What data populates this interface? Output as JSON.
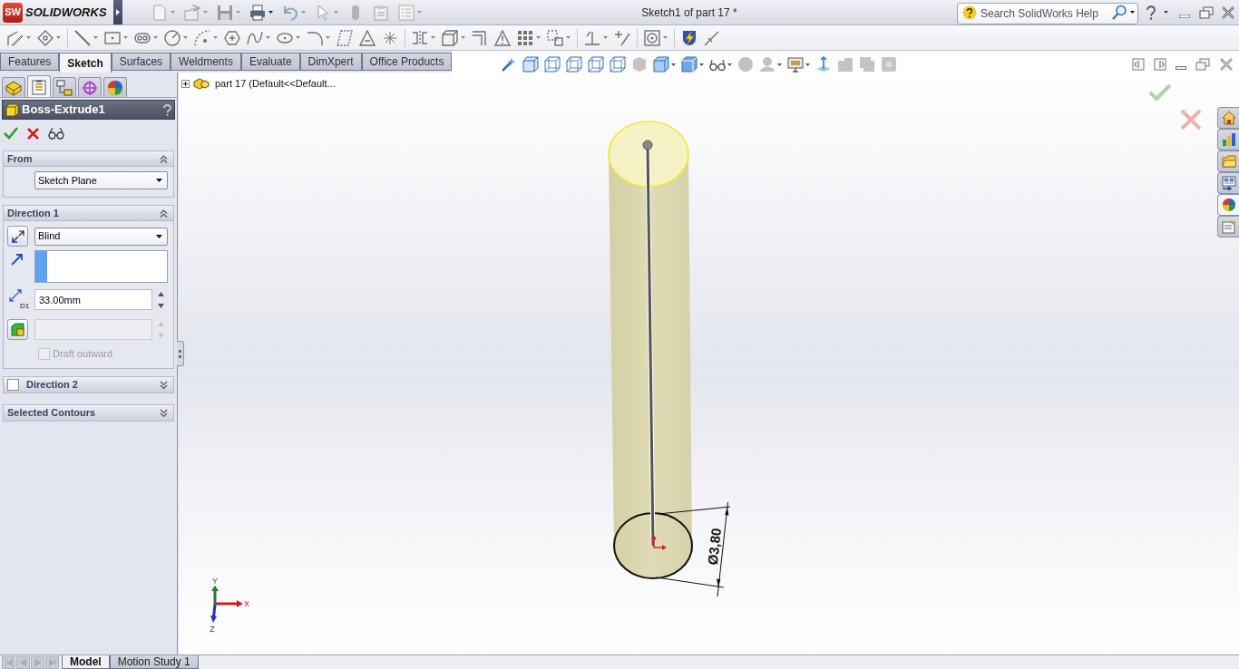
{
  "title_bar": {
    "logo_badge": "SW",
    "wordmark": "SOLIDWORKS",
    "title": "Sketch1 of part 17 *",
    "search": {
      "placeholder": "Search SolidWorks Help"
    }
  },
  "command_tabs": [
    {
      "label": "Features",
      "selected": false
    },
    {
      "label": "Sketch",
      "selected": true
    },
    {
      "label": "Surfaces",
      "selected": false
    },
    {
      "label": "Weldments",
      "selected": false
    },
    {
      "label": "Evaluate",
      "selected": false
    },
    {
      "label": "DimXpert",
      "selected": false
    },
    {
      "label": "Office Products",
      "selected": false
    }
  ],
  "panel_tabs": [
    {
      "kind": "feature-tree",
      "selected": false
    },
    {
      "kind": "property",
      "selected": true
    },
    {
      "kind": "configuration",
      "selected": false
    },
    {
      "kind": "dimxpert",
      "selected": false
    },
    {
      "kind": "display",
      "selected": false
    }
  ],
  "property_manager": {
    "title": "Boss-Extrude1",
    "groups": [
      {
        "title": "From",
        "expanded": true,
        "start_condition": "Sketch Plane"
      },
      {
        "title": "Direction 1",
        "expanded": true,
        "end_condition": "Blind",
        "depth_icon_label": "D1",
        "depth": "33.00mm",
        "draft_angle": {
          "disabled": true
        },
        "draft_outward": {
          "label": "Draft outward",
          "checked": false,
          "disabled": true
        }
      },
      {
        "title": "Direction 2",
        "expanded": false,
        "checkbox": {
          "checked": false
        }
      },
      {
        "title": "Selected Contours",
        "expanded": false
      }
    ]
  },
  "feature_tree": {
    "label": "part 17 (Default<<Default...",
    "expanded": false
  },
  "dimension": {
    "text": "Ø3,80"
  },
  "triad": {
    "x": "X",
    "y": "Y",
    "z": "Z"
  },
  "task_pane_tabs": [
    {
      "kind": "home",
      "selected": false
    },
    {
      "kind": "library",
      "selected": false
    },
    {
      "kind": "folder",
      "selected": false
    },
    {
      "kind": "palette",
      "selected": false
    },
    {
      "kind": "appearance",
      "selected": true
    },
    {
      "kind": "properties",
      "selected": false
    }
  ],
  "bottom_tabs": [
    {
      "label": "Model",
      "selected": true
    },
    {
      "label": "Motion Study 1",
      "selected": false
    }
  ]
}
